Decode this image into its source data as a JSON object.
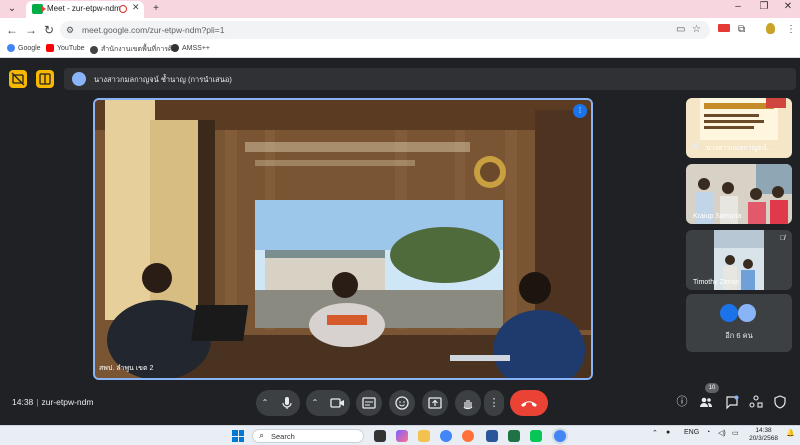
{
  "browser": {
    "tab_title": "Meet - zur-etpw-ndm",
    "url": "meet.google.com/zur-etpw-ndm?pli=1",
    "new_tab_label": "+",
    "bookmarks": [
      {
        "label": "Google",
        "color": "#4285f4"
      },
      {
        "label": "YouTube",
        "color": "#ff0000"
      },
      {
        "label": "สำนักงานเขตพื้นที่การศึ...",
        "color": "#444444"
      },
      {
        "label": "AMSS++",
        "color": "#333333"
      }
    ]
  },
  "meet": {
    "presenter_name": "นางสาวกมลกาญจน์ ช้ำนาญ (การนำเสนอ)",
    "main_tile_caption": "สพป. ลำพูน เขต 2",
    "participants": [
      {
        "name": "นางสาวกมลกาญจน์..."
      },
      {
        "name": "Kraiup Samana"
      },
      {
        "name": "Timothy Zense"
      }
    ],
    "more_label": "อีก 6 คน",
    "meeting_time": "14:38",
    "meeting_code": "zur-etpw-ndm",
    "people_count": "10",
    "accent_color": "#8ab4f8",
    "end_call_color": "#ea4335"
  },
  "taskbar": {
    "search_placeholder": "Search",
    "language": "ENG",
    "time": "14:38",
    "date": "20/3/2568"
  }
}
